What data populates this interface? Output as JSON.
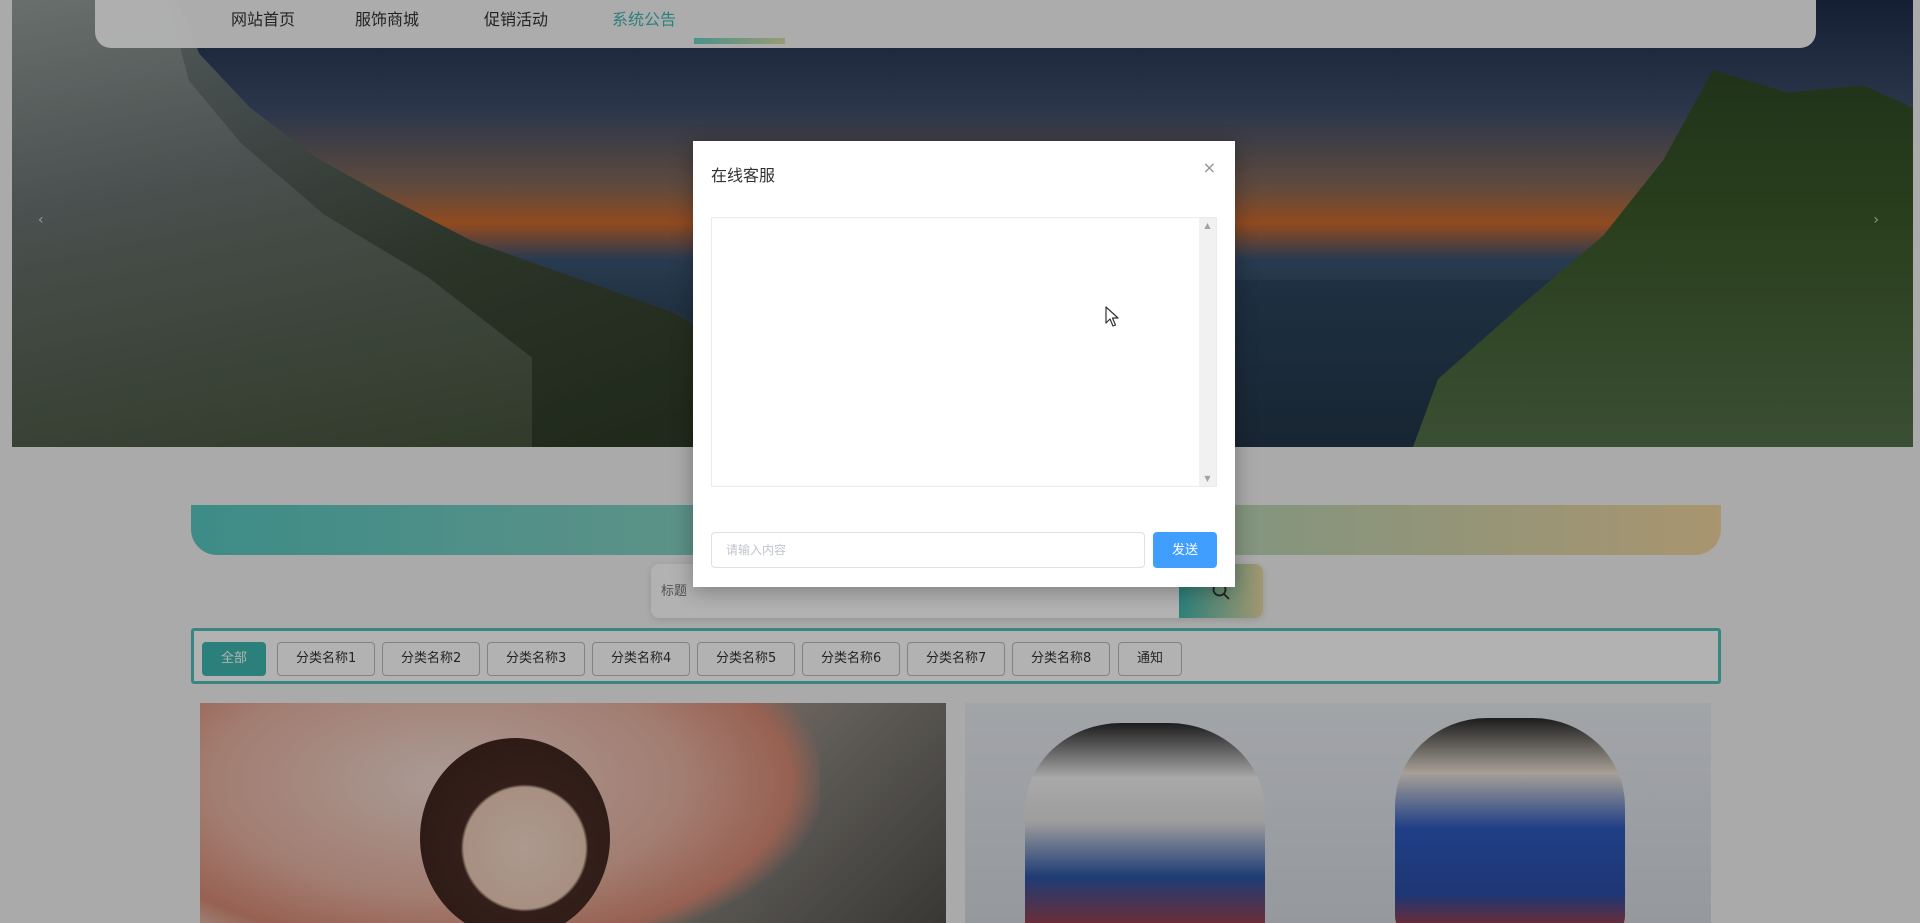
{
  "nav": {
    "items": [
      {
        "label": "网站首页",
        "active": false
      },
      {
        "label": "服饰商城",
        "active": false
      },
      {
        "label": "促销活动",
        "active": false
      },
      {
        "label": "系统公告",
        "active": true
      }
    ]
  },
  "banner": {
    "prev_icon": "chevron-left-icon",
    "next_icon": "chevron-right-icon",
    "prev_glyph": "‹",
    "next_glyph": "›"
  },
  "search": {
    "placeholder": "标题",
    "button_icon": "search-icon"
  },
  "categories": [
    {
      "label": "全部",
      "active": true
    },
    {
      "label": "分类名称1",
      "active": false
    },
    {
      "label": "分类名称2",
      "active": false
    },
    {
      "label": "分类名称3",
      "active": false
    },
    {
      "label": "分类名称4",
      "active": false
    },
    {
      "label": "分类名称5",
      "active": false
    },
    {
      "label": "分类名称6",
      "active": false
    },
    {
      "label": "分类名称7",
      "active": false
    },
    {
      "label": "分类名称8",
      "active": false
    },
    {
      "label": "通知",
      "active": false
    }
  ],
  "dialog": {
    "title": "在线客服",
    "close_glyph": "×",
    "input_placeholder": "请输入内容",
    "send_label": "发送"
  },
  "colors": {
    "accent": "#3fb8b0",
    "primary_button": "#409eff",
    "gradient_end": "#f2d6a0"
  }
}
